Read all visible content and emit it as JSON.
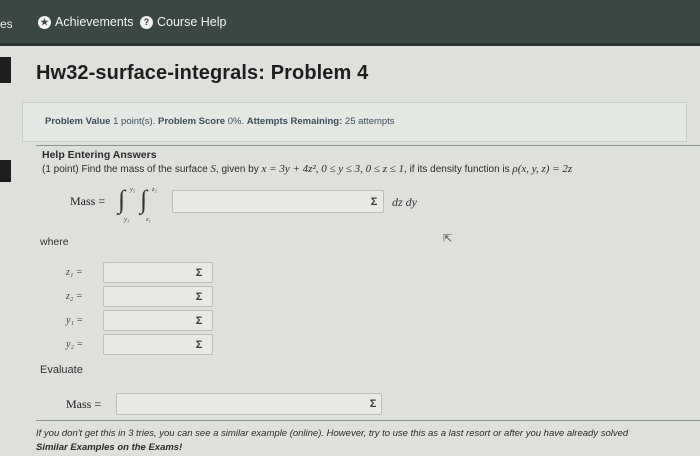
{
  "nav": {
    "cut_tab": "es",
    "achievements": "Achievements",
    "course_help": "Course Help"
  },
  "page": {
    "title": "Hw32-surface-integrals: Problem 4"
  },
  "info": {
    "value_label": "Problem Value",
    "value": "1 point(s).",
    "score_label": "Problem Score",
    "score": "0%.",
    "attempts_label": "Attempts Remaining:",
    "attempts": "25 attempts"
  },
  "problem": {
    "help_title": "Help Entering Answers",
    "text_pre": "(1 point) Find the mass of the surface",
    "surface": "S",
    "text_mid": ", given by",
    "equation": "x = 3y + 4z², 0 ≤ y ≤ 3, 0 ≤ z ≤ 1",
    "text_post": ", if its density function is",
    "density": "ρ(x, y, z) = 2z",
    "mass_label": "Mass =",
    "integral_sign": "∫",
    "upper_outer": "y₂",
    "lower_outer": "y₁",
    "upper_inner": "z₂",
    "lower_inner": "z₁",
    "integral_tail": "dz dy",
    "where": "where",
    "evaluate": "Evaluate",
    "final_mass_label": "Mass ="
  },
  "answers": {
    "integrand_value": "",
    "z1_label": "z₁ =",
    "z1_value": "",
    "z2_label": "z₂ =",
    "z2_value": "",
    "y1_label": "y₁ =",
    "y1_value": "",
    "y2_label": "y₂ =",
    "y2_value": "",
    "mass_value": "",
    "sigma": "Σ"
  },
  "footer": {
    "hint": "If you don't get this in 3 tries, you can see a similar example (online). However, try to use this as a last resort or after you have already solved",
    "hint_bold": "Similar Examples on the Exams!"
  },
  "icons": {
    "achievements": "star-icon",
    "course_help": "question-icon",
    "equation_editor": "sigma-icon",
    "cursor": "mouse-pointer-icon"
  },
  "colors": {
    "topbar": "#3a4742",
    "page_bg": "#dde0db",
    "info_text": "#3c4d5c",
    "input_bg": "#e6e9e4"
  }
}
